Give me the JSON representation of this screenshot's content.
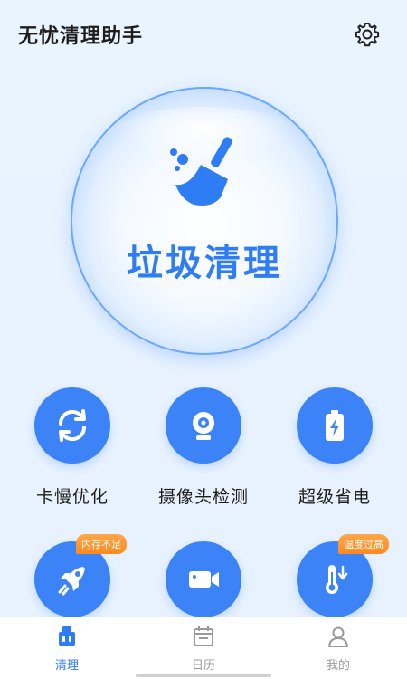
{
  "header": {
    "title": "无忧清理助手",
    "settings_icon": "gear-icon"
  },
  "main_button": {
    "label": "垃圾清理",
    "icon": "broom-icon"
  },
  "features": [
    {
      "label": "卡慢优化",
      "icon": "refresh-icon",
      "badge": ""
    },
    {
      "label": "摄像头检测",
      "icon": "webcam-icon",
      "badge": ""
    },
    {
      "label": "超级省电",
      "icon": "battery-icon",
      "badge": ""
    },
    {
      "label": "",
      "icon": "rocket-icon",
      "badge": "内存不足"
    },
    {
      "label": "",
      "icon": "video-icon",
      "badge": ""
    },
    {
      "label": "",
      "icon": "thermometer-icon",
      "badge": "温度过高"
    }
  ],
  "tabs": [
    {
      "label": "清理",
      "icon": "clean-icon",
      "active": true
    },
    {
      "label": "日历",
      "icon": "calendar-icon",
      "active": false
    },
    {
      "label": "我的",
      "icon": "user-icon",
      "active": false
    }
  ],
  "colors": {
    "accent": "#3b83f6",
    "badge": "#ff8a1f",
    "tab_active": "#2f7df5",
    "tab_inactive": "#9a9a9a"
  }
}
